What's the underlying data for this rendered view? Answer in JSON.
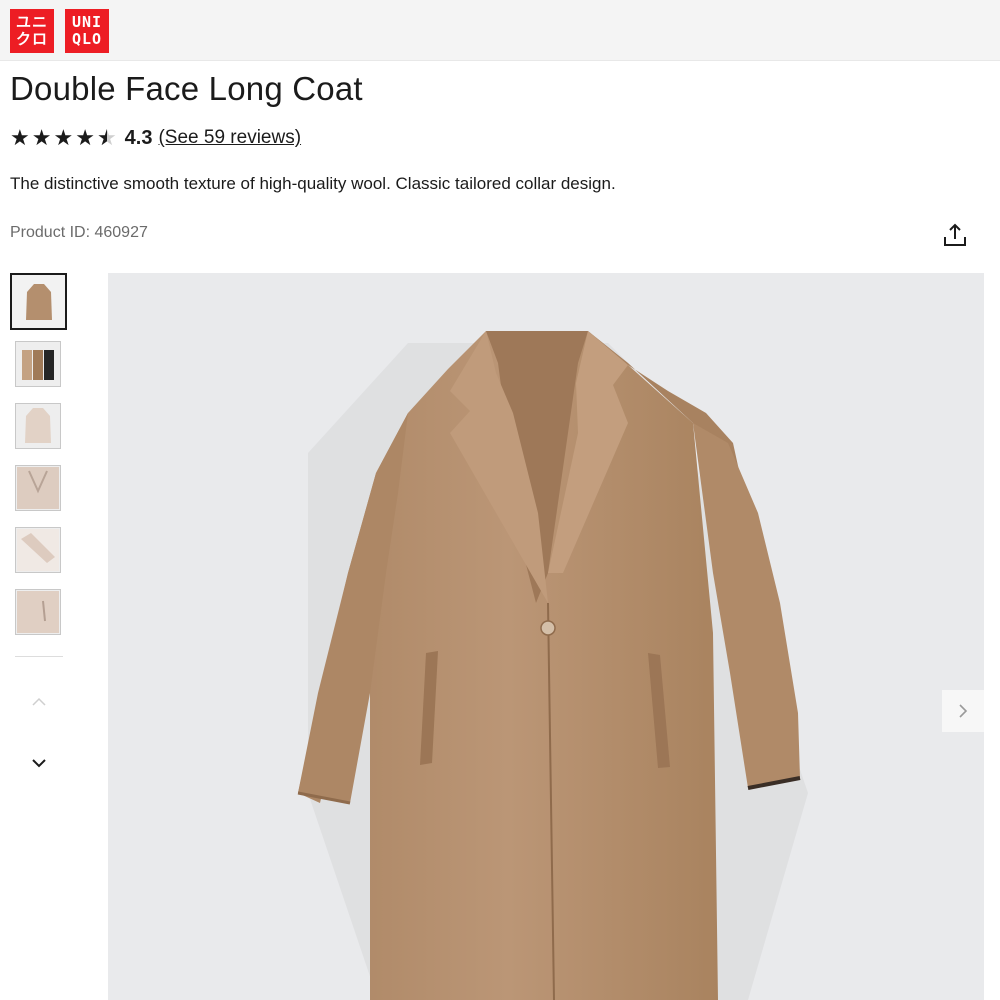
{
  "header": {
    "logo_jp": "ユニ\nクロ",
    "logo_en": "UNI\nQLO",
    "brand_color": "#ed1d24"
  },
  "product": {
    "title": "Double Face Long Coat",
    "rating_value": "4.3",
    "rating_stars": 4.3,
    "reviews_link": "(See 59 reviews)",
    "description": "The distinctive smooth texture of high-quality wool. Classic tailored collar design.",
    "product_id": "Product ID: 460927"
  },
  "icons": {
    "share": "share-icon",
    "scroll_up": "chevron-up-icon",
    "scroll_down": "chevron-down-icon",
    "next": "chevron-right-icon",
    "star": "star-icon"
  },
  "gallery": {
    "thumbnail_count": 6,
    "selected_index": 0,
    "coat_color": "#b89373",
    "background_color": "#e9eaec"
  }
}
